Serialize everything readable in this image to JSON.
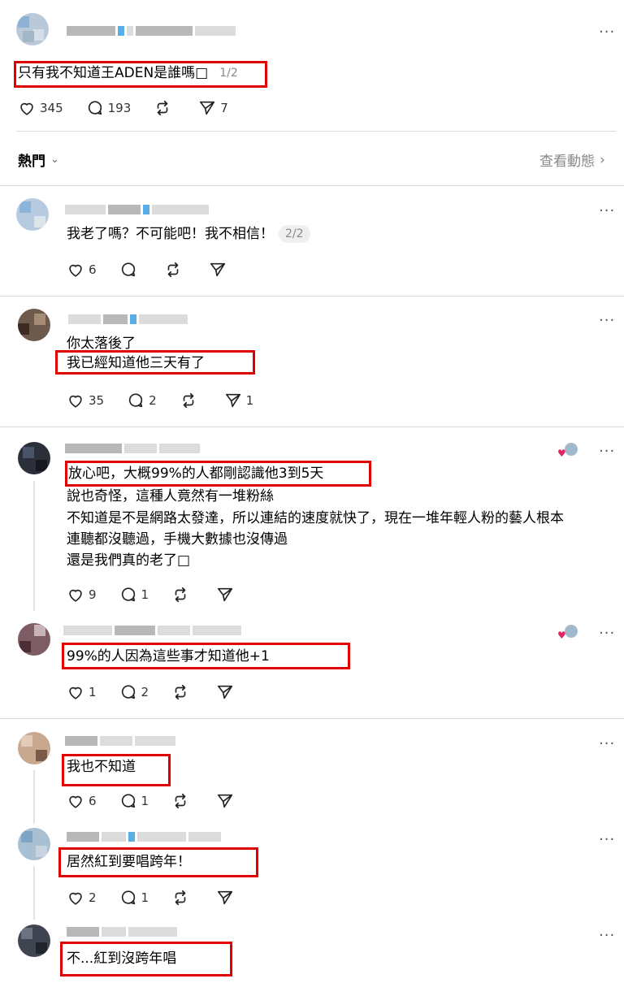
{
  "post": {
    "title": "只有我不知道王ADEN是誰嗎□",
    "page": "1/2",
    "likes": "345",
    "comments": "193",
    "shares": "7"
  },
  "sort": {
    "label": "熱門",
    "activity_link": "查看動態"
  },
  "replies": [
    {
      "text_lines": [
        "我老了嗎？不可能吧！我不相信！"
      ],
      "page": "2/2",
      "likes": "6",
      "comments": "",
      "shares": ""
    },
    {
      "text_lines": [
        "你太落後了",
        "我已經知道他三天有了"
      ],
      "likes": "35",
      "comments": "2",
      "shares": "1"
    },
    {
      "text_lines": [
        "放心吧，大概99%的人都剛認識他3到5天",
        "說也奇怪，這種人竟然有一堆粉絲",
        "不知道是不是網路太發達，所以連結的速度就快了，現在一堆年輕人粉的藝人根本",
        "連聽都沒聽過，手機大數據也沒傳過",
        "還是我們真的老了□"
      ],
      "likes": "9",
      "comments": "1",
      "shares": ""
    },
    {
      "text_lines": [
        "99%的人因為這些事才知道他+1"
      ],
      "likes": "1",
      "comments": "2",
      "shares": ""
    },
    {
      "text_lines": [
        "我也不知道"
      ],
      "likes": "6",
      "comments": "1",
      "shares": ""
    },
    {
      "text_lines": [
        "居然紅到要唱跨年！"
      ],
      "likes": "2",
      "comments": "1",
      "shares": ""
    },
    {
      "text_lines": [
        "不...紅到沒跨年唱"
      ]
    }
  ],
  "colors": {
    "highlight": "#e00000",
    "divider": "#dcdcdc",
    "muted": "#888888"
  },
  "icons": [
    "heart-icon",
    "comment-icon",
    "repost-icon",
    "send-icon",
    "more-icon",
    "chevron-down-icon",
    "chevron-right-icon"
  ]
}
